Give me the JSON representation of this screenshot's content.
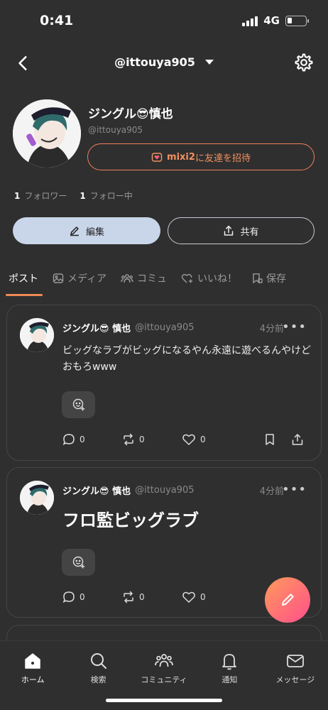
{
  "status": {
    "time": "0:41",
    "network": "4G"
  },
  "header": {
    "title": "@ittouya905"
  },
  "profile": {
    "name": "ジングル😎慎也",
    "handle": "@ittouya905",
    "invite_brand": "mixi2",
    "invite_text": "に友達を招待",
    "followers_count": "1",
    "followers_label": "フォロワー",
    "following_count": "1",
    "following_label": "フォロー中",
    "edit_label": "編集",
    "share_label": "共有"
  },
  "tabs": [
    {
      "label": "ポスト",
      "icon": "none"
    },
    {
      "label": "メディア",
      "icon": "image-icon"
    },
    {
      "label": "コミュ",
      "icon": "community-icon"
    },
    {
      "label": "いいね！",
      "icon": "heart-plus-icon"
    },
    {
      "label": "保存",
      "icon": "bookmark-icon"
    }
  ],
  "posts": [
    {
      "name": "ジングル😎 慎也",
      "handle": "@ittouya905",
      "time": "4分前",
      "body": "ビッグなラブがビッグになるやん永遠に遊べるんやけどおもろwww",
      "reply_count": "0",
      "repost_count": "0",
      "like_count": "0"
    },
    {
      "name": "ジングル😎 慎也",
      "handle": "@ittouya905",
      "time": "4分前",
      "body": "フロ監ビッグラブ",
      "reply_count": "0",
      "repost_count": "0",
      "like_count": "0"
    }
  ],
  "nav": [
    {
      "label": "ホーム",
      "icon": "home-icon"
    },
    {
      "label": "検索",
      "icon": "search-icon"
    },
    {
      "label": "コミュニティ",
      "icon": "community-icon"
    },
    {
      "label": "通知",
      "icon": "bell-icon"
    },
    {
      "label": "メッセージ",
      "icon": "mail-icon"
    }
  ],
  "colors": {
    "accent": "#f08a55",
    "background": "#2f2f2f",
    "edit_button": "#c9d6ea"
  }
}
